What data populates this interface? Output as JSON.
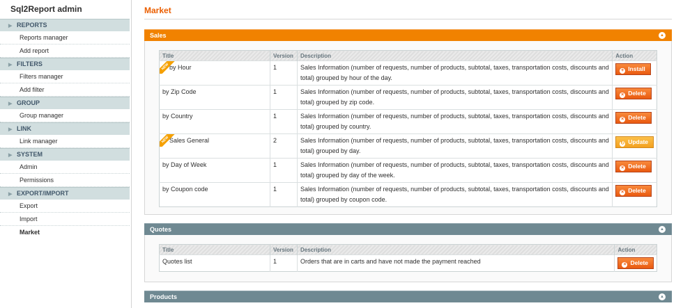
{
  "app": {
    "title": "Sql2Report admin"
  },
  "sidebar": {
    "groups": [
      {
        "label": "REPORTS",
        "items": [
          "Reports manager",
          "Add report"
        ]
      },
      {
        "label": "FILTERS",
        "items": [
          "Filters manager",
          "Add filter"
        ]
      },
      {
        "label": "GROUP",
        "items": [
          "Group manager"
        ]
      },
      {
        "label": "LINK",
        "items": [
          "Link manager"
        ]
      },
      {
        "label": "SYSTEM",
        "items": [
          "Admin",
          "Permissions"
        ]
      },
      {
        "label": "EXPORT/IMPORT",
        "items": [
          "Export",
          "Import"
        ]
      }
    ],
    "active": "Market"
  },
  "page": {
    "title": "Market"
  },
  "columns": {
    "title": "Title",
    "version": "Version",
    "description": "Description",
    "action": "Action"
  },
  "badge": "NEW",
  "sections": {
    "sales": {
      "label": "Sales",
      "rows": [
        {
          "title": "by Hour",
          "version": "1",
          "is_new": true,
          "action": "Install",
          "desc": "Sales Information (number of requests, number of products, subtotal, taxes, transportation costs, discounts and total) grouped by hour of the day."
        },
        {
          "title": "by Zip Code",
          "version": "1",
          "is_new": false,
          "action": "Delete",
          "desc": "Sales Information (number of requests, number of products, subtotal, taxes, transportation costs, discounts and total) grouped by zip code."
        },
        {
          "title": "by Country",
          "version": "1",
          "is_new": false,
          "action": "Delete",
          "desc": "Sales Information (number of requests, number of products, subtotal, taxes, transportation costs, discounts and total) grouped by country."
        },
        {
          "title": "Sales General",
          "version": "2",
          "is_new": true,
          "action": "Update",
          "desc": "Sales Information (number of requests, number of products, subtotal, taxes, transportation costs, discounts and total) grouped by day."
        },
        {
          "title": "by Day of Week",
          "version": "1",
          "is_new": false,
          "action": "Delete",
          "desc": "Sales Information (number of requests, number of products, subtotal, taxes, transportation costs, discounts and total) grouped by day of the week."
        },
        {
          "title": "by Coupon code",
          "version": "1",
          "is_new": false,
          "action": "Delete",
          "desc": "Sales Information (number of requests, number of products, subtotal, taxes, transportation costs, discounts and total) grouped by coupon code."
        }
      ]
    },
    "quotes": {
      "label": "Quotes",
      "rows": [
        {
          "title": "Quotes list",
          "version": "1",
          "is_new": false,
          "action": "Delete",
          "desc": "Orders that are in carts and have not made the payment reached"
        }
      ]
    },
    "products": {
      "label": "Products"
    }
  },
  "colors": {
    "accent": "#eb5e00",
    "sales_header": "#f18200",
    "section_header": "#6f8992"
  }
}
